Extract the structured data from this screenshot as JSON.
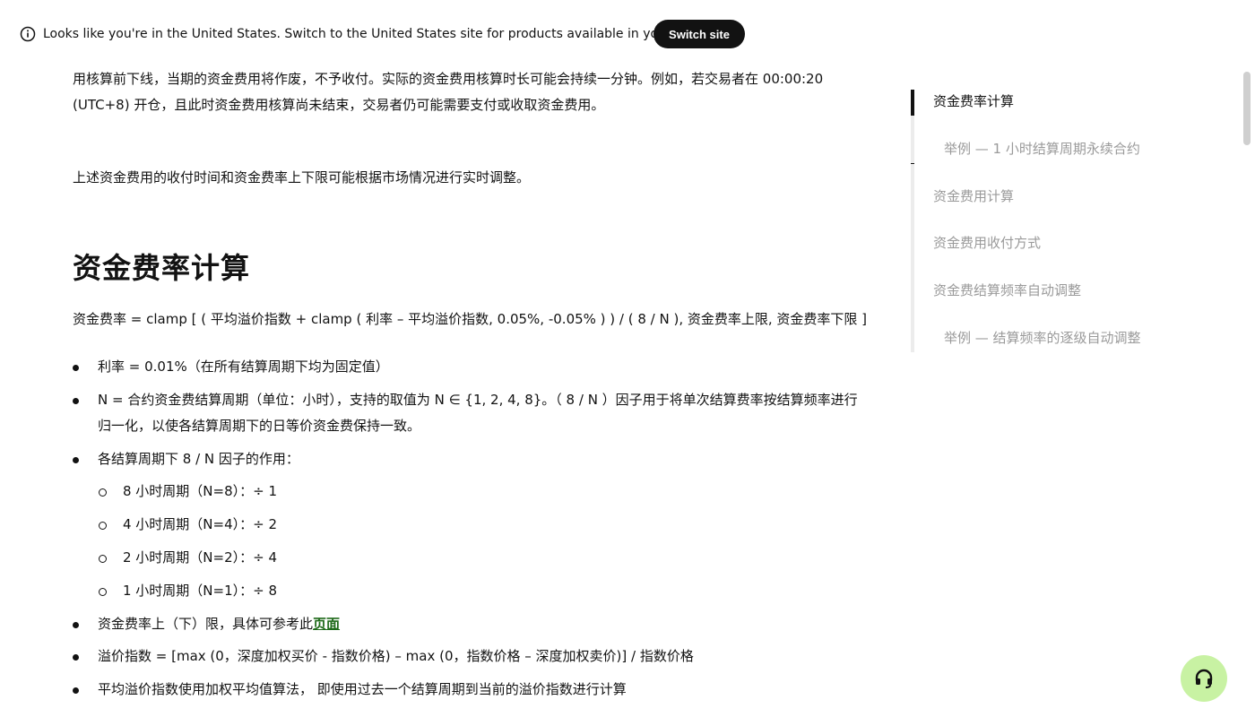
{
  "banner": {
    "text": "Looks like you're in the United States. Switch to the United States site for products available in your region.",
    "button_label": "Switch site"
  },
  "article": {
    "para1_line1": "用核算前下线，当期的资金费用将作废，不予收付。实际的资金费用核算时长可能会持续一分钟。例如，若交易者在 00:00:20",
    "para1_line2": "(UTC+8) 开仓，且此时资金费用核算尚未结束，交易者仍可能需要支付或收取资金费用。",
    "para2": "上述资金费用的收付时间和资金费率上下限可能根据市场情况进行实时调整。",
    "heading": "资金费率计算",
    "formula": "资金费率 = clamp [ ( 平均溢价指数 + clamp ( 利率 – 平均溢价指数, 0.05%, -0.05% ) ) / ( 8 / N ), 资金费率上限, 资金费率下限 ]",
    "bullets": {
      "interest": "利率 = 0.01%（在所有结算周期下均为固定值）",
      "n_line1": "N = 合约资金费结算周期（单位：小时），支持的取值为 N ∈ {1, 2, 4, 8}。（ 8 / N ）因子用于将单次结算费率按结算频率进行",
      "n_line2": "归一化，以使各结算周期下的日等价资金费保持一致。",
      "factor": "各结算周期下 8 / N 因子的作用：",
      "sub": [
        "8 小时周期（N=8）：÷ 1",
        "4 小时周期（N=4）：÷ 2",
        "2 小时周期（N=2）：÷ 4",
        "1 小时周期（N=1）：÷ 8"
      ],
      "cap_prefix": "资金费率上（下）限，具体可参考此",
      "cap_link": "页面",
      "premium": "溢价指数 = [max (0，深度加权买价 - 指数价格) – max (0，指数价格 – 深度加权卖价)] / 指数价格",
      "avg_premium": "平均溢价指数使用加权平均值算法， 即使用过去一个结算周期到当前的溢价指数进行计算"
    }
  },
  "toc": {
    "items": [
      "资金费率计算",
      "举例 — 1 小时结算周期永续合约",
      "资金费用计算",
      "资金费用收付方式",
      "资金费结算频率自动调整",
      "举例 — 结算频率的逐级自动调整"
    ]
  },
  "icons": {
    "info": "info-icon",
    "support": "headset-icon"
  },
  "colors": {
    "link": "#1f6a1a",
    "support_button": "#c8f2a3",
    "toc_muted": "#9a9a9a"
  }
}
